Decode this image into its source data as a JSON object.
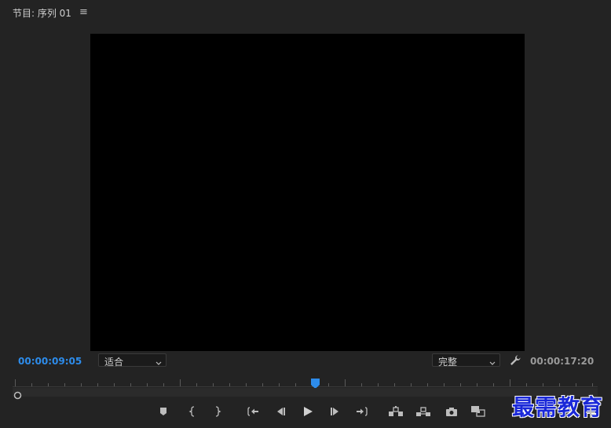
{
  "panel": {
    "title": "节目: 序列 01",
    "menu_icon": "hamburger-menu-icon"
  },
  "timecode": {
    "current": "00:00:09:05",
    "duration": "00:00:17:20"
  },
  "zoom_select": {
    "value": "适合"
  },
  "quality_select": {
    "value": "完整"
  },
  "playhead": {
    "position_fraction": 0.518
  },
  "controls": [
    {
      "name": "add-marker",
      "icon": "marker-icon"
    },
    {
      "name": "mark-in",
      "icon": "mark-in-icon"
    },
    {
      "name": "mark-out",
      "icon": "mark-out-icon"
    },
    {
      "name": "go-to-in",
      "icon": "go-to-in-icon"
    },
    {
      "name": "step-back",
      "icon": "step-back-icon"
    },
    {
      "name": "play",
      "icon": "play-icon"
    },
    {
      "name": "step-forward",
      "icon": "step-forward-icon"
    },
    {
      "name": "go-to-out",
      "icon": "go-to-out-icon"
    },
    {
      "name": "lift",
      "icon": "lift-icon"
    },
    {
      "name": "extract",
      "icon": "extract-icon"
    },
    {
      "name": "export-frame",
      "icon": "camera-icon"
    },
    {
      "name": "compare-view",
      "icon": "compare-icon"
    }
  ],
  "watermark": {
    "text": "最需教育"
  },
  "colors": {
    "background": "#232323",
    "monitor": "#000000",
    "accent_timecode": "#2d8ceb",
    "playhead": "#2d8ceb"
  }
}
